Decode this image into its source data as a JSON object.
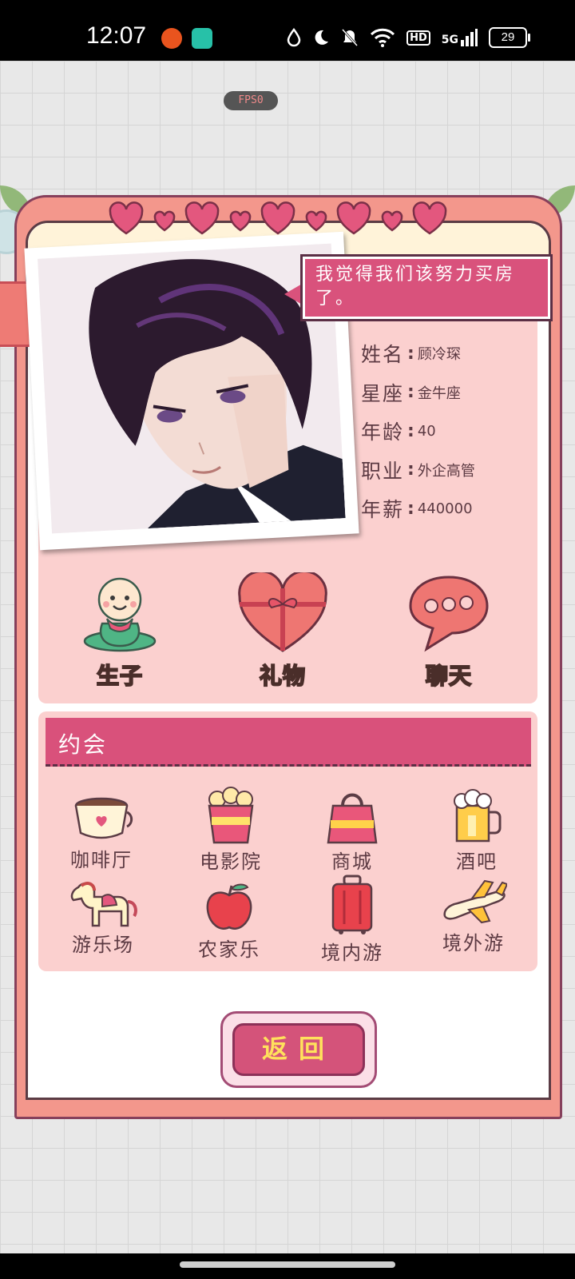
{
  "status_bar": {
    "time": "12:07",
    "network": "5G",
    "hd": "HD",
    "battery": "29"
  },
  "fps_label": "FPS0",
  "speech_bubble": "我觉得我们该努力买房了。",
  "profile": [
    {
      "label": "姓名",
      "value": "顾冷琛"
    },
    {
      "label": "星座",
      "value": "金牛座"
    },
    {
      "label": "年龄",
      "value": "40"
    },
    {
      "label": "职业",
      "value": "外企高管"
    },
    {
      "label": "年薪",
      "value": "440000"
    }
  ],
  "actions": [
    {
      "label": "生子",
      "icon": "baby-icon"
    },
    {
      "label": "礼物",
      "icon": "gift-heart-icon"
    },
    {
      "label": "聊天",
      "icon": "chat-bubble-icon"
    }
  ],
  "dating": {
    "title": "约会",
    "venues": [
      {
        "label": "咖啡厅",
        "icon": "coffee-cup-icon"
      },
      {
        "label": "电影院",
        "icon": "popcorn-icon"
      },
      {
        "label": "商城",
        "icon": "shopping-bag-icon"
      },
      {
        "label": "酒吧",
        "icon": "beer-mug-icon"
      },
      {
        "label": "游乐场",
        "icon": "carousel-horse-icon"
      },
      {
        "label": "农家乐",
        "icon": "apple-icon"
      },
      {
        "label": "境内游",
        "icon": "suitcase-icon"
      },
      {
        "label": "境外游",
        "icon": "airplane-icon"
      }
    ]
  },
  "return_button": "返回",
  "colors": {
    "panel": "#f3978c",
    "accent": "#d9517b",
    "card": "#fbd0cf",
    "button_text": "#ffd634"
  }
}
